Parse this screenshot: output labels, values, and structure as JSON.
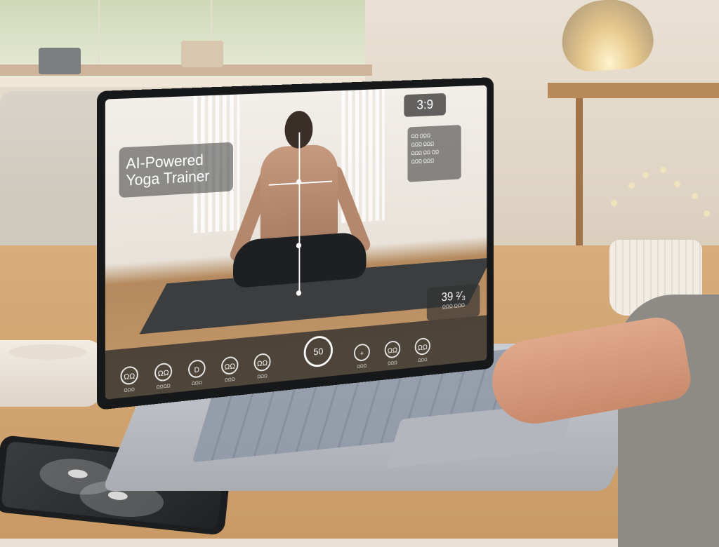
{
  "app": {
    "title": "AI-Powered Yoga Trainer",
    "title_line1": "AI-Powered",
    "title_line2": "Yoga Trainer"
  },
  "overlay": {
    "timer": "3:9",
    "stats": [
      "ΩΩ ΩΩΩ",
      "ΩΩΩ ΩΩΩ",
      "ΩΩΩ ΩΩ ΩΩ",
      "ΩΩΩ ΩΩΩ"
    ],
    "score": "39 ²⁄₃",
    "score_label": "ΩΩΩ ΩΩΩ"
  },
  "controls": {
    "play_label": "50",
    "items": [
      {
        "icon": "ΩΩ",
        "label": "ΩΩΩ"
      },
      {
        "icon": "ΩΩ",
        "label": "ΩΩΩΩ"
      },
      {
        "icon": "D",
        "label": "ΩΩΩ"
      },
      {
        "icon": "ΩΩ",
        "label": "ΩΩΩ"
      },
      {
        "icon": "ΩΩ",
        "label": "ΩΩΩ"
      },
      {
        "icon": "+",
        "label": "ΩΩΩ"
      },
      {
        "icon": "ΩΩ",
        "label": "ΩΩΩ"
      },
      {
        "icon": "ΩΩ",
        "label": "ΩΩΩ"
      }
    ]
  },
  "colors": {
    "overlay_bg": "#3c3c3c",
    "overlay_text": "#ffffff",
    "mat": "#3b3d3f"
  }
}
